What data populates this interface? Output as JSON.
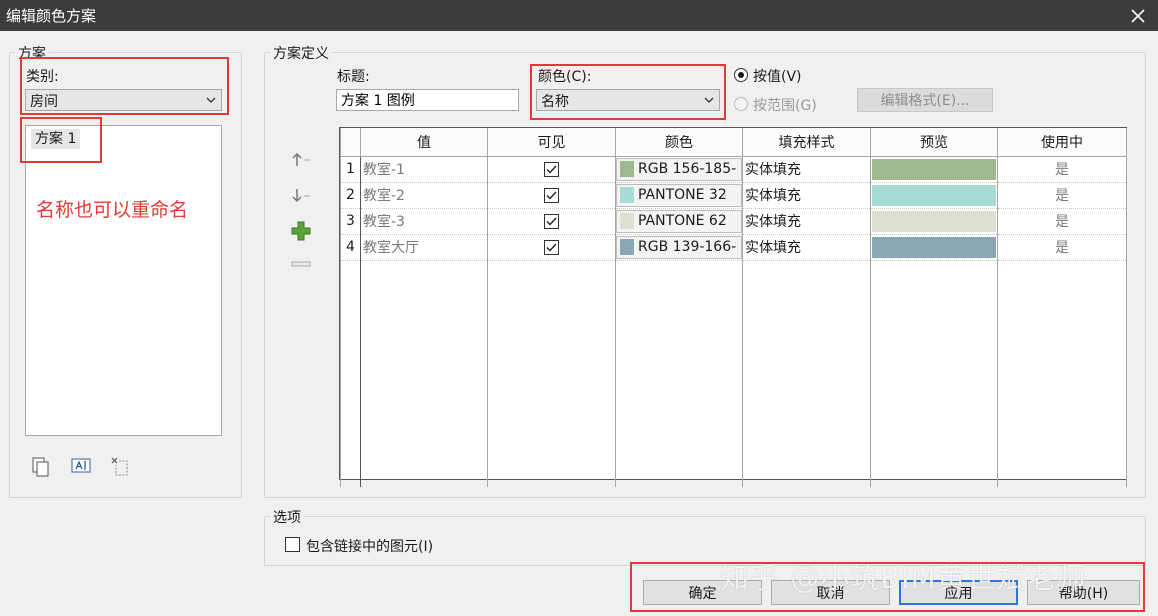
{
  "window": {
    "title": "编辑颜色方案"
  },
  "left_panel": {
    "group_label": "方案",
    "category_label": "类别:",
    "category_value": "房间",
    "schemes": [
      "方案 1"
    ],
    "annotation": "名称也可以重命名"
  },
  "definition": {
    "group_label": "方案定义",
    "title_label": "标题:",
    "title_value": "方案 1 图例",
    "color_label": "颜色(C):",
    "color_value": "名称",
    "by_value_label": "按值(V)",
    "by_range_label": "按范围(G)",
    "edit_format_label": "编辑格式(E)..."
  },
  "table": {
    "columns": [
      "值",
      "可见",
      "颜色",
      "填充样式",
      "预览",
      "使用中"
    ],
    "rows": [
      {
        "num": "1",
        "value": "教室-1",
        "visible": true,
        "color_text": "RGB 156-185-",
        "swatch": "#9cb98f",
        "fill": "实体填充",
        "preview": "#9cb98f",
        "in_use": "是"
      },
      {
        "num": "2",
        "value": "教室-2",
        "visible": true,
        "color_text": "PANTONE 32",
        "swatch": "#a6dbd6",
        "fill": "实体填充",
        "preview": "#a6dbd6",
        "in_use": "是"
      },
      {
        "num": "3",
        "value": "教室-3",
        "visible": true,
        "color_text": "PANTONE 62",
        "swatch": "#dcdfd2",
        "fill": "实体填充",
        "preview": "#dcdfd2",
        "in_use": "是"
      },
      {
        "num": "4",
        "value": "教室大厅",
        "visible": true,
        "color_text": "RGB 139-166-",
        "swatch": "#8ba6b5",
        "fill": "实体填充",
        "preview": "#8ba6b5",
        "in_use": "是"
      }
    ]
  },
  "options": {
    "group_label": "选项",
    "include_linked_label": "包含链接中的图元(I)",
    "include_linked_checked": false
  },
  "buttons": {
    "ok": "确定",
    "cancel": "取消",
    "apply": "应用",
    "help": "帮助(H)"
  },
  "watermark": "知乎 @小筑BIM黄世斌老师",
  "colors": {
    "annotation_red": "#e23a36",
    "titlebar": "#3c3c3c",
    "focus_blue": "#2a79d8"
  }
}
